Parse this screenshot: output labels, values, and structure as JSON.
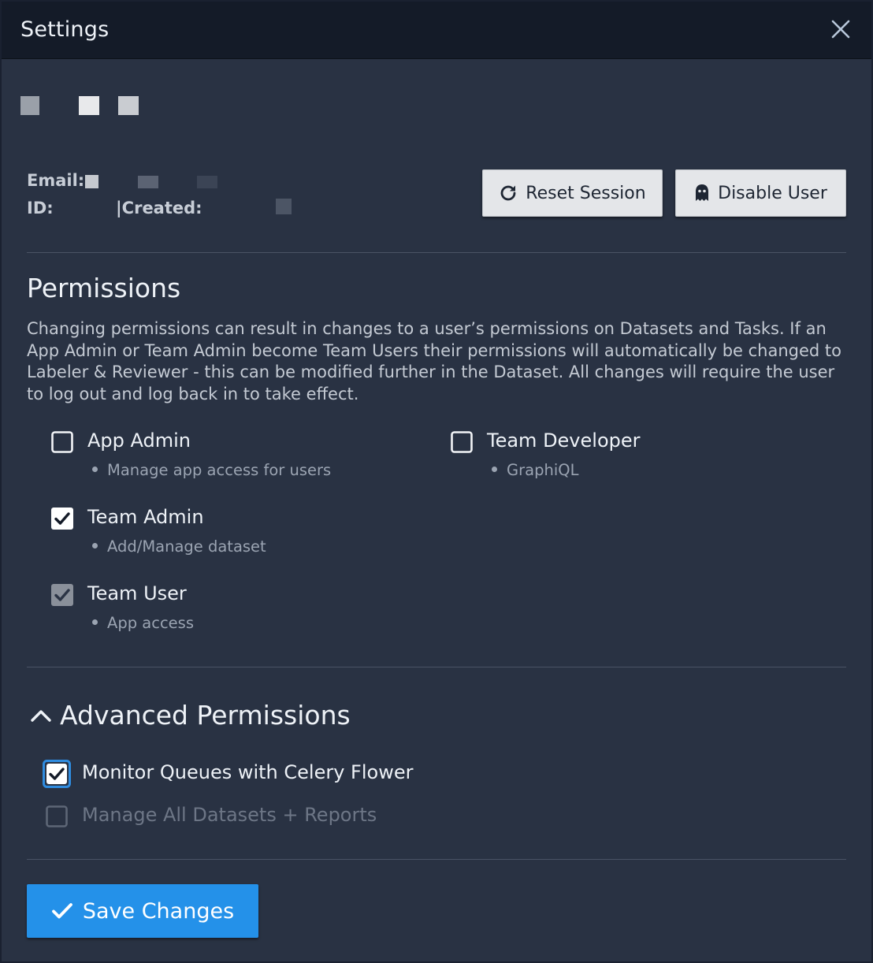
{
  "header": {
    "title": "Settings"
  },
  "user_info": {
    "email_label": "Email:",
    "id_label": "ID:",
    "created_label": "|Created:"
  },
  "actions": {
    "reset_session_label": "Reset Session",
    "disable_user_label": "Disable User"
  },
  "permissions": {
    "title": "Permissions",
    "description": "Changing permissions can result in changes to a user’s permissions on Datasets and Tasks. If an App Admin or Team Admin become Team Users their permissions will automatically be changed to Labeler & Reviewer - this can be modified further in the Dataset. All changes will require the user to log out and log back in to take effect.",
    "items": [
      {
        "label": "App Admin",
        "detail": "Manage app access for users",
        "checked": false,
        "disabled": false
      },
      {
        "label": "Team Admin",
        "detail": "Add/Manage dataset",
        "checked": true,
        "disabled": false
      },
      {
        "label": "Team User",
        "detail": "App access",
        "checked": true,
        "disabled": true
      },
      {
        "label": "Team Developer",
        "detail": "GraphiQL",
        "checked": false,
        "disabled": false
      }
    ]
  },
  "advanced": {
    "title": "Advanced Permissions",
    "expanded": true,
    "items": [
      {
        "label": "Monitor Queues with Celery Flower",
        "checked": true,
        "disabled": false,
        "focused": true
      },
      {
        "label": "Manage All Datasets + Reports",
        "checked": false,
        "disabled": true
      }
    ]
  },
  "footer": {
    "save_label": "Save Changes"
  },
  "colors": {
    "header_bg": "#141b28",
    "panel_bg": "#293243",
    "primary": "#2491e9",
    "focus_ring": "#2f8ce0"
  }
}
